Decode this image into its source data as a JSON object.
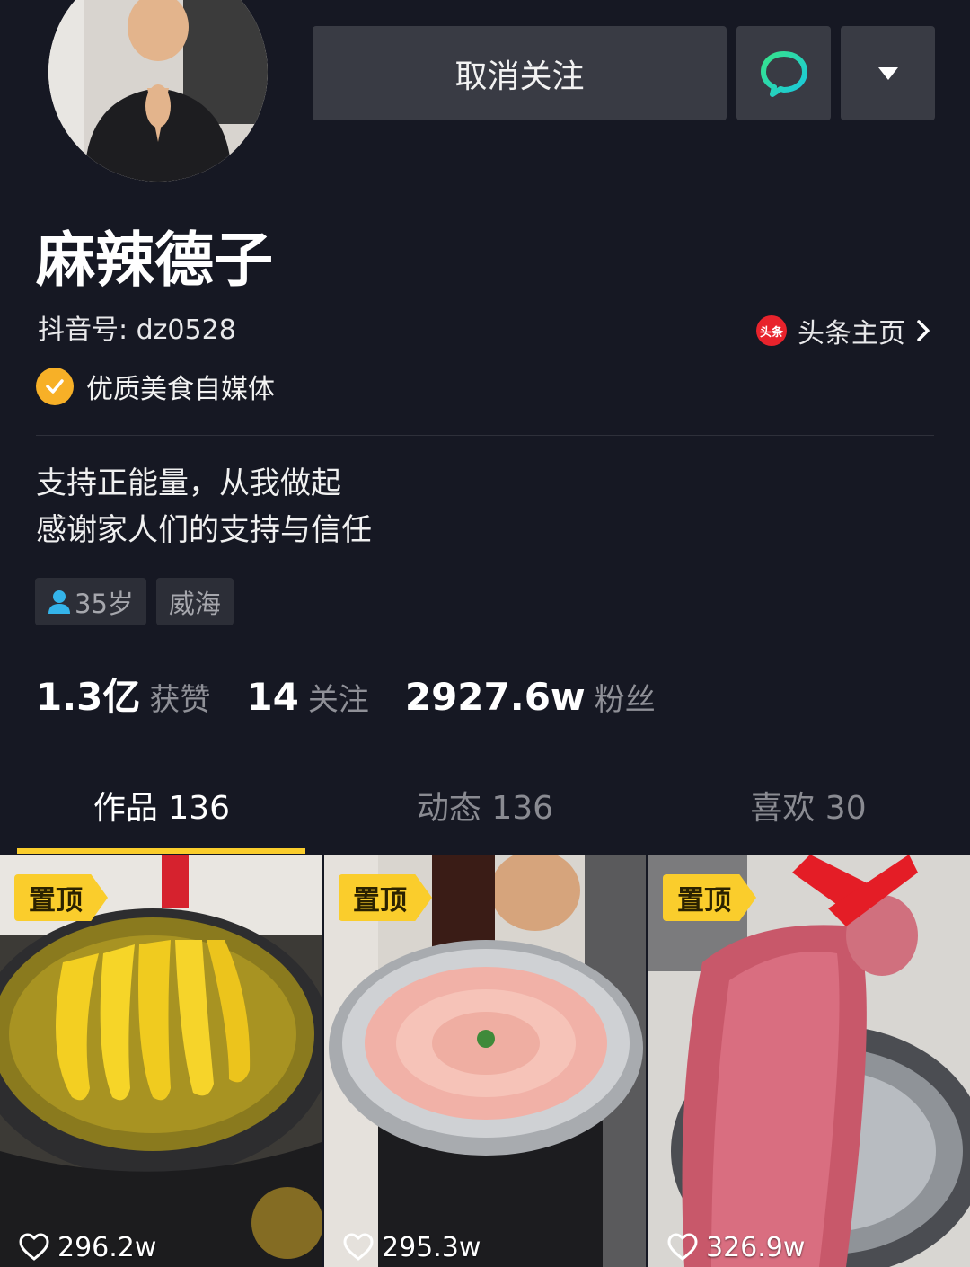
{
  "profile": {
    "name": "麻辣德子",
    "douyin_id": "抖音号: dz0528",
    "toutiao_label": "头条主页",
    "toutiao_logo_text": "头条",
    "verification": "优质美食自媒体",
    "bio_line1": "支持正能量，从我做起",
    "bio_line2": "感谢家人们的支持与信任",
    "tags": [
      "35岁",
      "威海"
    ]
  },
  "actions": {
    "unfollow_label": "取消关注"
  },
  "stats": {
    "likes_value": "1.3亿",
    "likes_label": "获赞",
    "following_value": "14",
    "following_label": "关注",
    "followers_value": "2927.6w",
    "followers_label": "粉丝"
  },
  "tabs": [
    {
      "label": "作品 136"
    },
    {
      "label": "动态 136"
    },
    {
      "label": "喜欢 30"
    }
  ],
  "videos": [
    {
      "pin": "置顶",
      "likes": "296.2w"
    },
    {
      "pin": "置顶",
      "likes": "295.3w"
    },
    {
      "pin": "置顶",
      "likes": "326.9w"
    }
  ],
  "colors": {
    "background": "#161823",
    "accent_yellow": "#facd2c",
    "message_green": "#20d5b5",
    "verify_orange": "#f7b027"
  }
}
